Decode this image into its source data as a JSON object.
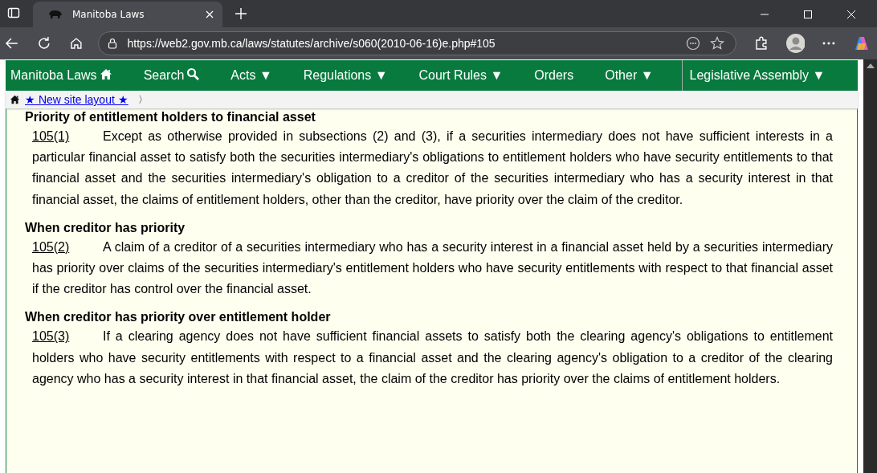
{
  "browser": {
    "tab_title": "Manitoba Laws",
    "url": "https://web2.gov.mb.ca/laws/statutes/archive/s060(2010-06-16)e.php#105"
  },
  "nav": {
    "items": [
      {
        "label": "Manitoba Laws",
        "kind": "home"
      },
      {
        "label": "Search",
        "kind": "search"
      },
      {
        "label": "Acts ▼",
        "kind": "plain"
      },
      {
        "label": "Regulations ▼",
        "kind": "plain"
      },
      {
        "label": "Court Rules ▼",
        "kind": "plain"
      },
      {
        "label": "Orders",
        "kind": "plain"
      },
      {
        "label": "Other ▼",
        "kind": "plain"
      },
      {
        "label": "Legislative Assembly ▼",
        "kind": "divided"
      }
    ]
  },
  "breadcrumb": {
    "link": "★ New site layout ★",
    "separator": "〉"
  },
  "sections": [
    {
      "heading": "Priority of entitlement holders to financial asset",
      "number": "105(1)",
      "text": "Except as otherwise provided in subsections (2) and (3), if a securities intermediary does not have sufficient interests in a particular financial asset to satisfy both the securities intermediary's obligations to entitlement holders who have security entitlements to that financial asset and the securities intermediary's obligation to a creditor of the securities intermediary who has a security interest in that financial asset, the claims of entitlement holders, other than the creditor, have priority over the claim of the creditor."
    },
    {
      "heading": "When creditor has priority",
      "number": "105(2)",
      "text": "A claim of a creditor of a securities intermediary who has a security interest in a financial asset held by a securities intermediary has priority over claims of the securities intermediary's entitlement holders who have security entitlements with respect to that financial asset if the creditor has control over the financial asset."
    },
    {
      "heading": "When creditor has priority over entitlement holder",
      "number": "105(3)",
      "text": "If a clearing agency does not have sufficient financial assets to satisfy both the clearing agency's obligations to entitlement holders who have security entitlements with respect to a financial asset and the clearing agency's obligation to a creditor of the clearing agency who has a security interest in that financial asset, the claim of the creditor has priority over the claims of entitlement holders."
    }
  ]
}
